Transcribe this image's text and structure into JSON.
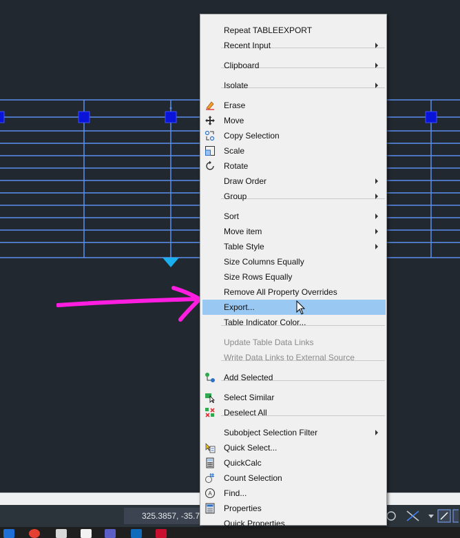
{
  "menu": {
    "items": [
      {
        "label": "Repeat TABLEEXPORT",
        "submenu": false
      },
      {
        "label": "Recent Input",
        "submenu": true
      },
      {
        "label": "Clipboard",
        "submenu": true
      },
      {
        "label": "Isolate",
        "submenu": true
      },
      {
        "label": "Erase",
        "icon": "eraser-icon"
      },
      {
        "label": "Move",
        "icon": "move-icon"
      },
      {
        "label": "Copy Selection",
        "icon": "copy-icon"
      },
      {
        "label": "Scale",
        "icon": "scale-icon"
      },
      {
        "label": "Rotate",
        "icon": "rotate-icon"
      },
      {
        "label": "Draw Order",
        "submenu": true
      },
      {
        "label": "Group",
        "submenu": true
      },
      {
        "label": "Sort",
        "submenu": true
      },
      {
        "label": "Move item",
        "submenu": true
      },
      {
        "label": "Table Style",
        "submenu": true
      },
      {
        "label": "Size Columns Equally"
      },
      {
        "label": "Size Rows Equally"
      },
      {
        "label": "Remove All Property Overrides"
      },
      {
        "label": "Export...",
        "highlighted": true
      },
      {
        "label": "Table Indicator Color..."
      },
      {
        "label": "Update Table Data Links",
        "disabled": true
      },
      {
        "label": "Write Data Links to External Source",
        "disabled": true
      },
      {
        "label": "Add Selected",
        "icon": "add-selected-icon"
      },
      {
        "label": "Select Similar",
        "icon": "select-similar-icon"
      },
      {
        "label": "Deselect All",
        "icon": "deselect-all-icon"
      },
      {
        "label": "Subobject Selection Filter",
        "submenu": true
      },
      {
        "label": "Quick Select...",
        "icon": "quick-select-icon"
      },
      {
        "label": "QuickCalc",
        "icon": "calculator-icon"
      },
      {
        "label": "Count Selection",
        "icon": "count-icon"
      },
      {
        "label": "Find...",
        "icon": "find-icon"
      },
      {
        "label": "Properties",
        "icon": "properties-icon"
      },
      {
        "label": "Quick Properties"
      }
    ]
  },
  "status": {
    "coordinates": "325.3857, -35.7"
  },
  "colors": {
    "canvas": "#212830",
    "grid_line": "#4a7bd8",
    "grip": "#0a14d8",
    "annotation_arrow": "#ff1ee0",
    "menu_highlight": "#99c9f3"
  }
}
